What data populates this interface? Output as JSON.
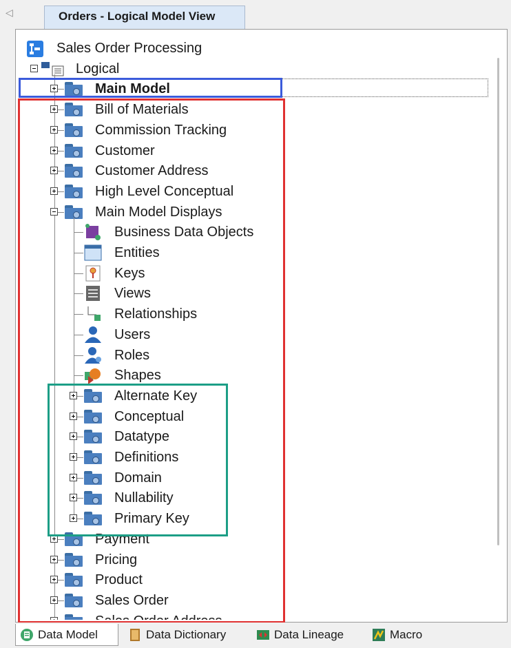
{
  "document_tab": {
    "label": "Orders - Logical Model View"
  },
  "tree": {
    "root": {
      "label": "Sales Order Processing",
      "icon": "model-root-icon"
    },
    "logical": {
      "label": "Logical",
      "icon": "logical-model-icon"
    },
    "main_model": {
      "label": "Main Model",
      "selected": true
    },
    "subject_areas": [
      {
        "label": "Bill of Materials"
      },
      {
        "label": "Commission Tracking"
      },
      {
        "label": "Customer"
      },
      {
        "label": "Customer Address"
      },
      {
        "label": "High Level Conceptual"
      },
      {
        "label": "Main Model Displays",
        "expanded": true
      }
    ],
    "display_children": [
      {
        "label": "Business Data Objects",
        "icon": "business-data-object-icon"
      },
      {
        "label": "Entities",
        "icon": "entity-icon"
      },
      {
        "label": "Keys",
        "icon": "key-icon"
      },
      {
        "label": "Views",
        "icon": "view-icon"
      },
      {
        "label": "Relationships",
        "icon": "relationship-icon"
      },
      {
        "label": "Users",
        "icon": "user-icon"
      },
      {
        "label": "Roles",
        "icon": "role-icon"
      },
      {
        "label": "Shapes",
        "icon": "shape-icon"
      }
    ],
    "display_folders": [
      {
        "label": "Alternate Key"
      },
      {
        "label": "Conceptual"
      },
      {
        "label": "Datatype"
      },
      {
        "label": "Definitions"
      },
      {
        "label": "Domain"
      },
      {
        "label": "Nullability"
      },
      {
        "label": "Primary Key"
      }
    ],
    "trailing_subject_areas": [
      {
        "label": "Payment"
      },
      {
        "label": "Pricing"
      },
      {
        "label": "Product"
      },
      {
        "label": "Sales Order"
      },
      {
        "label": "Sales Order Address"
      }
    ]
  },
  "bottom_tabs": [
    {
      "label": "Data Model",
      "active": true,
      "icon": "data-model-icon"
    },
    {
      "label": "Data Dictionary",
      "active": false,
      "icon": "data-dictionary-icon"
    },
    {
      "label": "Data Lineage",
      "active": false,
      "icon": "data-lineage-icon"
    },
    {
      "label": "Macro",
      "active": false,
      "icon": "macro-icon"
    }
  ],
  "colors": {
    "highlight_blue": "#3b5bdb",
    "highlight_red": "#e03131",
    "highlight_green": "#1c9e86",
    "folder_blue": "#4b7fbf"
  }
}
